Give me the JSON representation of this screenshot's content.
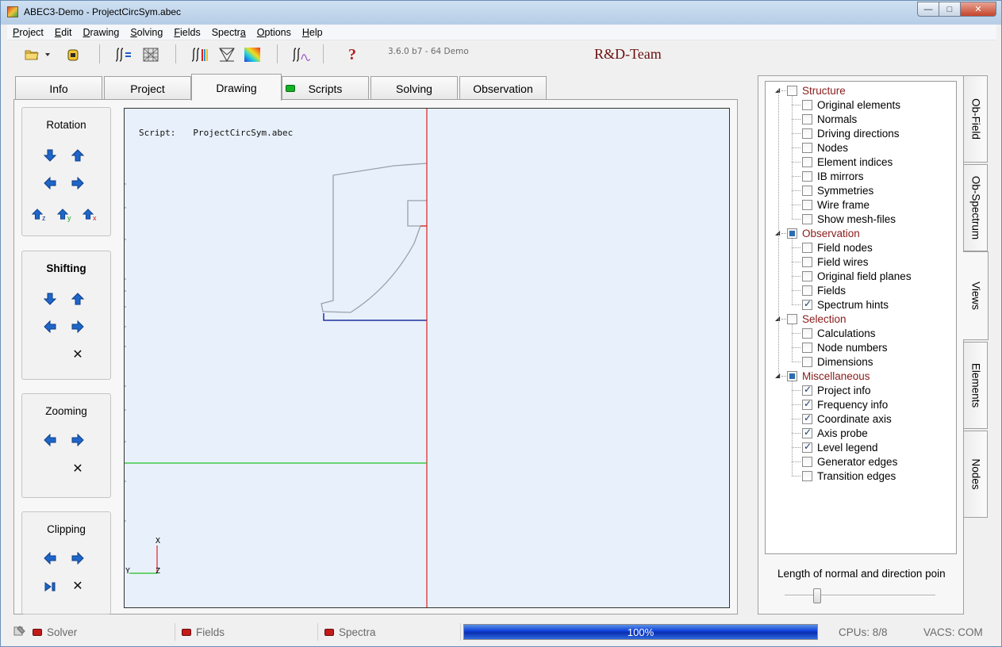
{
  "window": {
    "title": "ABEC3-Demo - ProjectCircSym.abec"
  },
  "menu": [
    {
      "label": "Project",
      "accel": "P"
    },
    {
      "label": "Edit",
      "accel": "E"
    },
    {
      "label": "Drawing",
      "accel": "D"
    },
    {
      "label": "Solving",
      "accel": "S"
    },
    {
      "label": "Fields",
      "accel": "F"
    },
    {
      "label": "Spectra",
      "accel": "a"
    },
    {
      "label": "Options",
      "accel": "O"
    },
    {
      "label": "Help",
      "accel": "H"
    }
  ],
  "toolbar": {
    "version": "3.6.0 b7 - 64 Demo",
    "team": "R&D-Team",
    "icons": [
      "open-folder-icon",
      "dropdown-arrow-icon",
      "database-icon",
      "solver-sum-icon",
      "mesh-icon",
      "spectra-sum-icon",
      "wire-pyramid-icon",
      "color-field-icon",
      "probe-sum-icon",
      "help-icon"
    ]
  },
  "tabs": [
    {
      "label": "Info"
    },
    {
      "label": "Project"
    },
    {
      "label": "Drawing",
      "active": true
    },
    {
      "label": "Scripts",
      "led": "green"
    },
    {
      "label": "Solving"
    },
    {
      "label": "Observation"
    }
  ],
  "controls": {
    "rotation": "Rotation",
    "shifting": "Shifting",
    "zooming": "Zooming",
    "clipping": "Clipping",
    "axis_subscripts": [
      "z",
      "y",
      "x"
    ]
  },
  "canvas": {
    "script_label": "Script:",
    "script_value": "ProjectCircSym.abec",
    "axis_x": "X",
    "axis_y": "Y",
    "axis_z": "Z",
    "colors": {
      "background": "#e8f1fb",
      "red_axis": "#e02020",
      "green_axis": "#20c020",
      "outline": "#9aa0a8",
      "blue_edge": "#2030a0"
    }
  },
  "tree": {
    "groups": [
      {
        "label": "Structure",
        "state": "unchecked",
        "items": [
          {
            "label": "Original elements",
            "checked": false
          },
          {
            "label": "Normals",
            "checked": false
          },
          {
            "label": "Driving directions",
            "checked": false
          },
          {
            "label": "Nodes",
            "checked": false
          },
          {
            "label": "Element indices",
            "checked": false
          },
          {
            "label": "IB mirrors",
            "checked": false
          },
          {
            "label": "Symmetries",
            "checked": false
          },
          {
            "label": "Wire frame",
            "checked": false
          },
          {
            "label": "Show mesh-files",
            "checked": false
          }
        ]
      },
      {
        "label": "Observation",
        "state": "partial",
        "items": [
          {
            "label": "Field nodes",
            "checked": false
          },
          {
            "label": "Field wires",
            "checked": false
          },
          {
            "label": "Original field planes",
            "checked": false
          },
          {
            "label": "Fields",
            "checked": false
          },
          {
            "label": "Spectrum hints",
            "checked": true
          }
        ]
      },
      {
        "label": "Selection",
        "state": "unchecked",
        "items": [
          {
            "label": "Calculations",
            "checked": false
          },
          {
            "label": "Node numbers",
            "checked": false
          },
          {
            "label": "Dimensions",
            "checked": false
          }
        ]
      },
      {
        "label": "Miscellaneous",
        "state": "partial",
        "items": [
          {
            "label": "Project info",
            "checked": true
          },
          {
            "label": "Frequency info",
            "checked": true
          },
          {
            "label": "Coordinate axis",
            "checked": true
          },
          {
            "label": "Axis probe",
            "checked": true
          },
          {
            "label": "Level legend",
            "checked": true
          },
          {
            "label": "Generator edges",
            "checked": false
          },
          {
            "label": "Transition edges",
            "checked": false
          }
        ]
      }
    ]
  },
  "length_label": "Length of normal and direction poin",
  "slider_value": 0.2,
  "vtabs": [
    {
      "label": "Ob-Field"
    },
    {
      "label": "Ob-Spectrum"
    },
    {
      "label": "Views",
      "active": true
    },
    {
      "label": "Elements"
    },
    {
      "label": "Nodes"
    }
  ],
  "status": {
    "solver": "Solver",
    "fields": "Fields",
    "spectra": "Spectra",
    "progress": "100%",
    "cpus": "CPUs: 8/8",
    "vacs": "VACS: COM"
  }
}
